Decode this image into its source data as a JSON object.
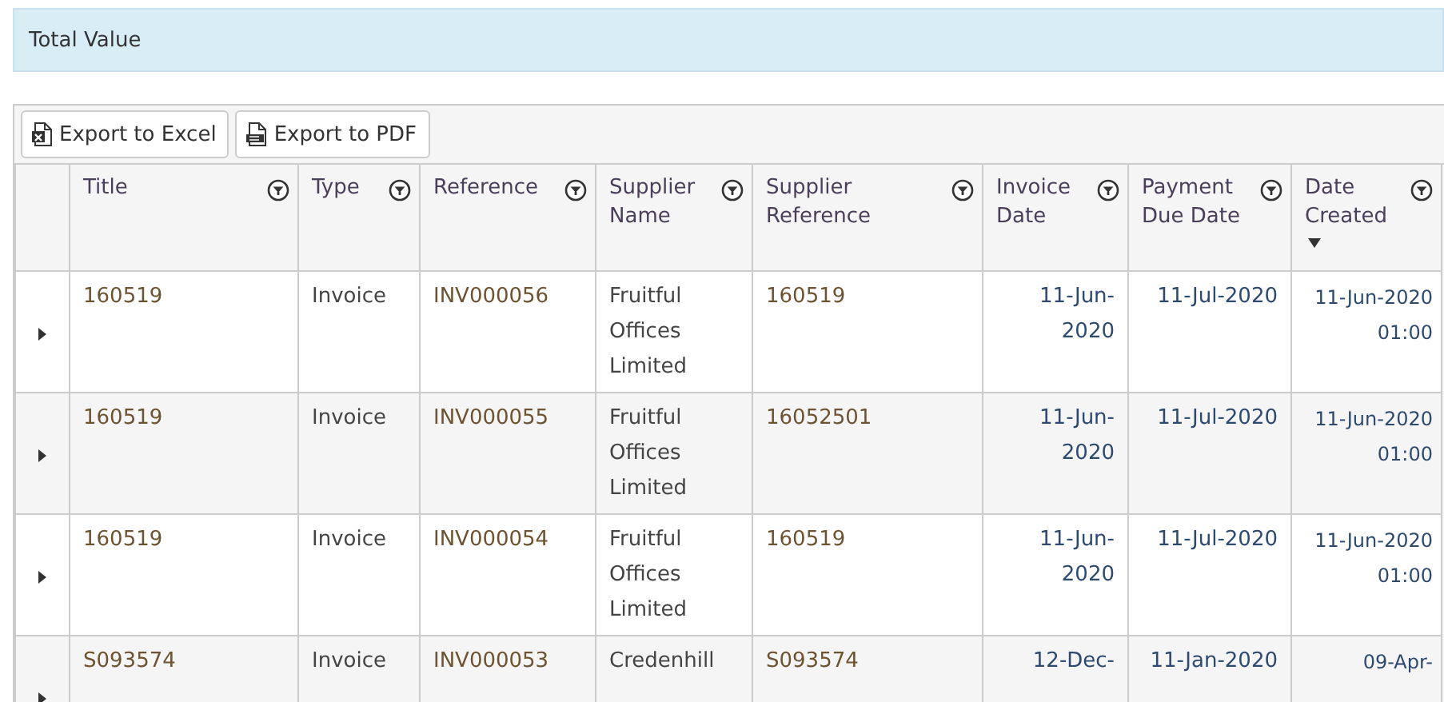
{
  "summary_bar": {
    "label": "Total Value"
  },
  "toolbar": {
    "buttons": [
      {
        "label": "Export to Excel",
        "kind": "excel"
      },
      {
        "label": "Export to PDF",
        "kind": "pdf"
      }
    ]
  },
  "table": {
    "columns": [
      {
        "label": "Title",
        "sorted": false
      },
      {
        "label": "Type",
        "sorted": false
      },
      {
        "label": "Reference",
        "sorted": false
      },
      {
        "label": "Supplier Name",
        "sorted": false
      },
      {
        "label": "Supplier Reference",
        "sorted": false
      },
      {
        "label": "Invoice Date",
        "sorted": false
      },
      {
        "label": "Payment Due Date",
        "sorted": false
      },
      {
        "label": "Date Created",
        "sorted": true
      }
    ],
    "rows": [
      {
        "cells": [
          "160519",
          "Invoice",
          "INV000056",
          "Fruitful Offices Limited",
          "160519",
          "11-Jun-2020",
          "11-Jul-2020",
          "11-Jun-2020 01:00"
        ]
      },
      {
        "cells": [
          "160519",
          "Invoice",
          "INV000055",
          "Fruitful Offices Limited",
          "16052501",
          "11-Jun-2020",
          "11-Jul-2020",
          "11-Jun-2020 01:00"
        ]
      },
      {
        "cells": [
          "160519",
          "Invoice",
          "INV000054",
          "Fruitful Offices Limited",
          "160519",
          "11-Jun-2020",
          "11-Jul-2020",
          "11-Jun-2020 01:00"
        ]
      },
      {
        "cells": [
          "S093574",
          "Invoice",
          "INV000053",
          "Credenhill",
          "S093574",
          "12-Dec-",
          "11-Jan-2020",
          "09-Apr-"
        ]
      }
    ]
  }
}
